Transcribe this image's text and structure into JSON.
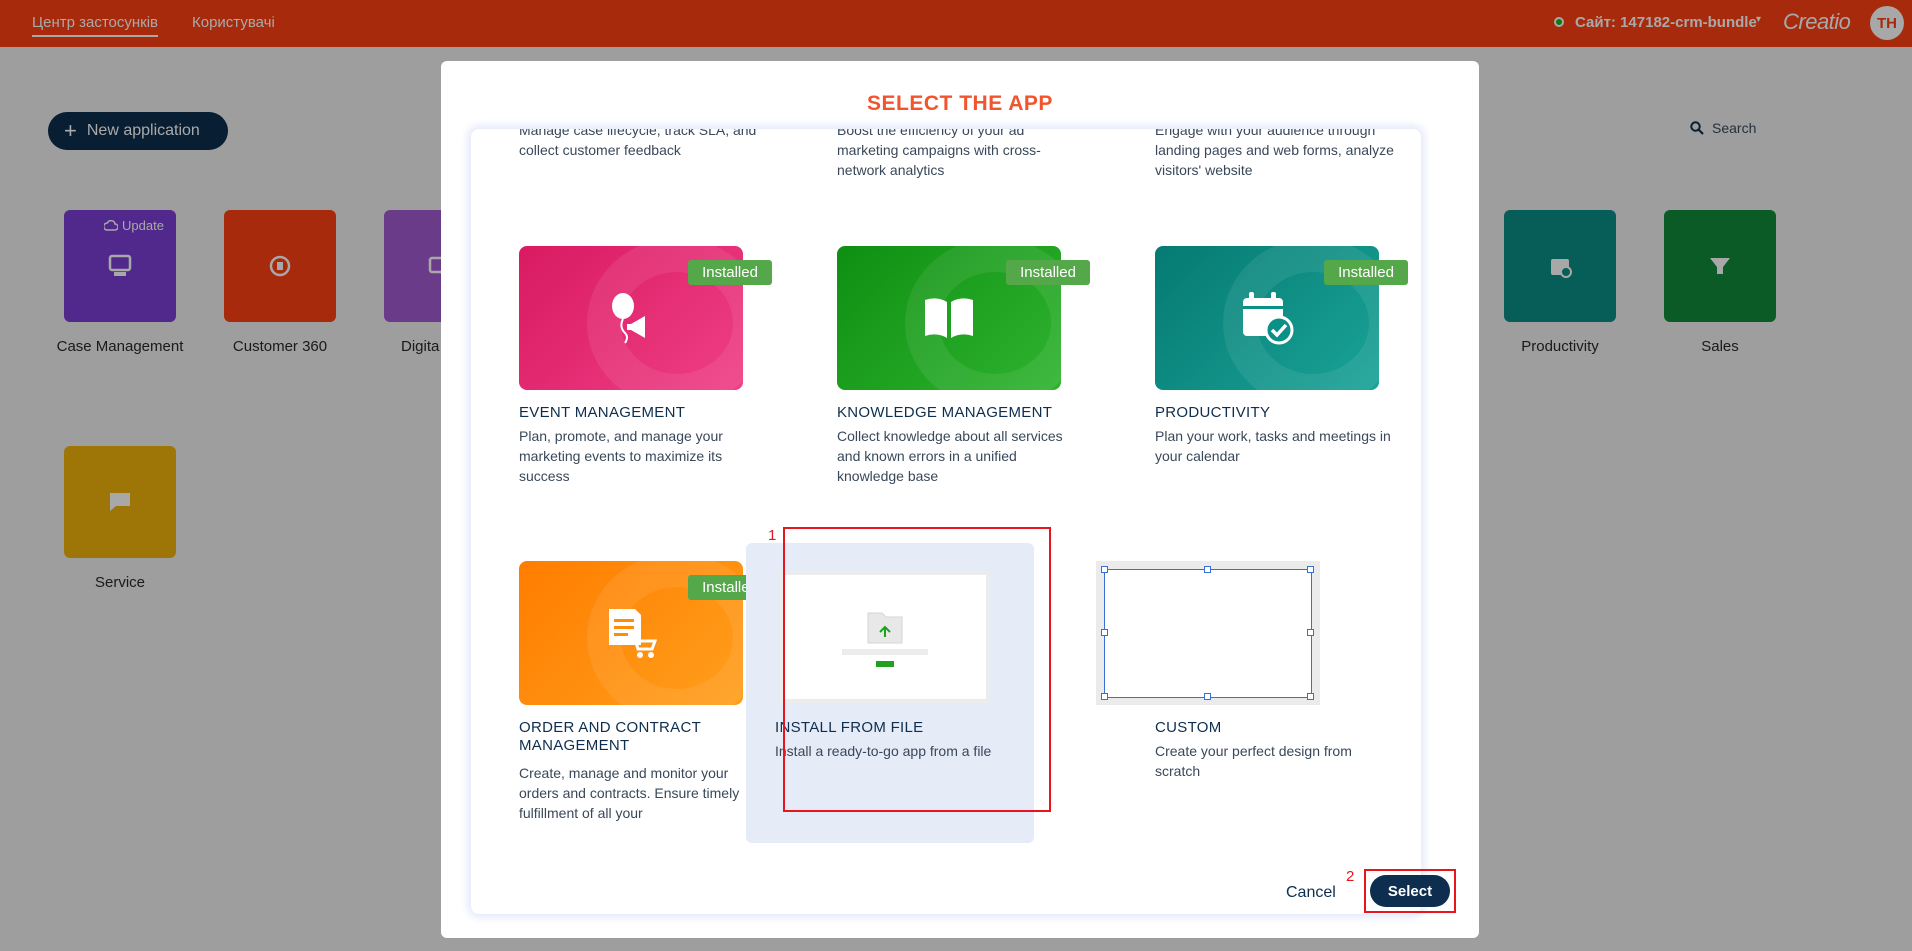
{
  "topbar": {
    "tabs": [
      {
        "label": "Центр застосунків",
        "active": true
      },
      {
        "label": "Користувачі",
        "active": false
      }
    ],
    "site_label": "Сайт: 147182-crm-bundle",
    "brand": "Creatio",
    "avatar_initials": "TH",
    "bg_color": "#ff4013"
  },
  "background": {
    "new_app_label": "New application",
    "search_label": "Search",
    "update_label": "Update",
    "tiles": [
      {
        "label": "Case Management",
        "color": "#7b3fd6"
      },
      {
        "label": "Customer 360",
        "color": "#ff4013"
      },
      {
        "label": "Digita",
        "color": "#a15ad1"
      },
      {
        "label": "Productivity",
        "color": "#0c8f86"
      },
      {
        "label": "Sales",
        "color": "#128a3a"
      },
      {
        "label": "Service",
        "color": "#f0b40b"
      }
    ]
  },
  "modal": {
    "title": "SELECT THE APP",
    "partial_top": [
      {
        "desc": "Manage case lifecycle, track SLA, and collect customer feedback"
      },
      {
        "desc": "Boost the efficiency of your ad marketing campaigns with cross-network analytics"
      },
      {
        "desc": "Engage with your audience through landing pages and web forms, analyze visitors' website"
      }
    ],
    "installed_label": "Installed",
    "cards": [
      {
        "title": "EVENT MANAGEMENT",
        "desc": "Plan, promote, and manage your marketing events to maximize its success",
        "color": "#e8246c",
        "installed": true,
        "icon": "balloon-megaphone-icon"
      },
      {
        "title": "KNOWLEDGE MANAGEMENT",
        "desc": "Collect knowledge about all services and known errors in a unified knowledge base",
        "color": "#18a01e",
        "installed": true,
        "icon": "book-icon"
      },
      {
        "title": "PRODUCTIVITY",
        "desc": "Plan your work, tasks and meetings in your calendar",
        "color": "#0a9086",
        "installed": true,
        "icon": "calendar-check-icon"
      },
      {
        "title": "ORDER AND CONTRACT MANAGEMENT",
        "desc": "Create, manage and monitor your orders and contracts. Ensure timely fulfillment of all your",
        "color": "#ff8c0a",
        "installed": true,
        "icon": "order-cart-icon"
      },
      {
        "title": "INSTALL FROM FILE",
        "desc": "Install a ready-to-go app from a file",
        "installed": false,
        "icon": "upload-folder-icon"
      },
      {
        "title": "CUSTOM",
        "desc": "Create your perfect design from scratch",
        "installed": false,
        "icon": "custom-frame-icon"
      }
    ],
    "annotation_1": "1",
    "annotation_2": "2",
    "cancel_label": "Cancel",
    "select_label": "Select"
  }
}
